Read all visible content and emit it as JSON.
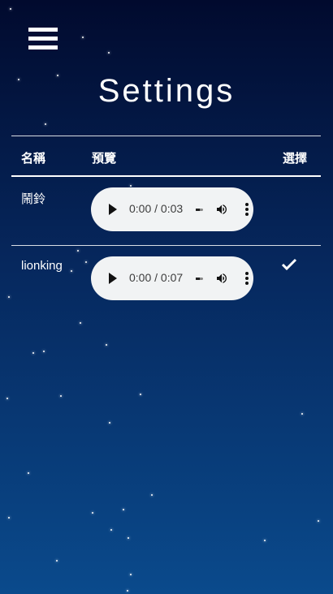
{
  "header": {
    "title": "Settings",
    "menu_icon": "hamburger-menu-icon"
  },
  "table": {
    "columns": [
      "名稱",
      "預覽",
      "選擇"
    ],
    "rows": [
      {
        "name": "鬧鈴",
        "time": "0:00 / 0:03",
        "selected": false
      },
      {
        "name": "lionking",
        "time": "0:00 / 0:07",
        "selected": true
      }
    ]
  },
  "colors": {
    "bg_top": "#010a2e",
    "bg_bottom": "#0a4a8c",
    "player_bg": "#f1f3f4"
  }
}
